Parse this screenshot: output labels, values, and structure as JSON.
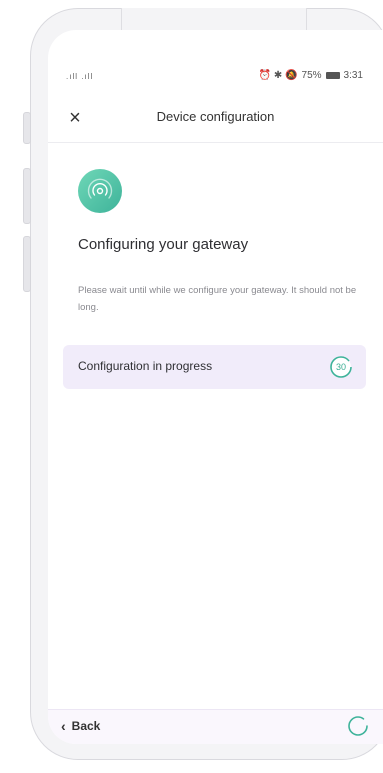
{
  "status_bar": {
    "signal": ".ıll .ıll",
    "icons": "⏰ ✱ 🔕",
    "battery_percent": "75%",
    "time": "3:31"
  },
  "header": {
    "close_icon": "close-icon",
    "title": "Device configuration"
  },
  "main": {
    "gateway_icon": "wifi-signal-icon",
    "heading": "Configuring your gateway",
    "description": "Please wait until while we configure your gateway. It should not be long.",
    "progress": {
      "label": "Configuration in progress",
      "countdown": "30"
    }
  },
  "footer": {
    "back_label": "Back",
    "spinner_icon": "loading-spinner-icon"
  },
  "colors": {
    "accent": "#3eb39a",
    "progress_card": "#f1ecfa"
  }
}
